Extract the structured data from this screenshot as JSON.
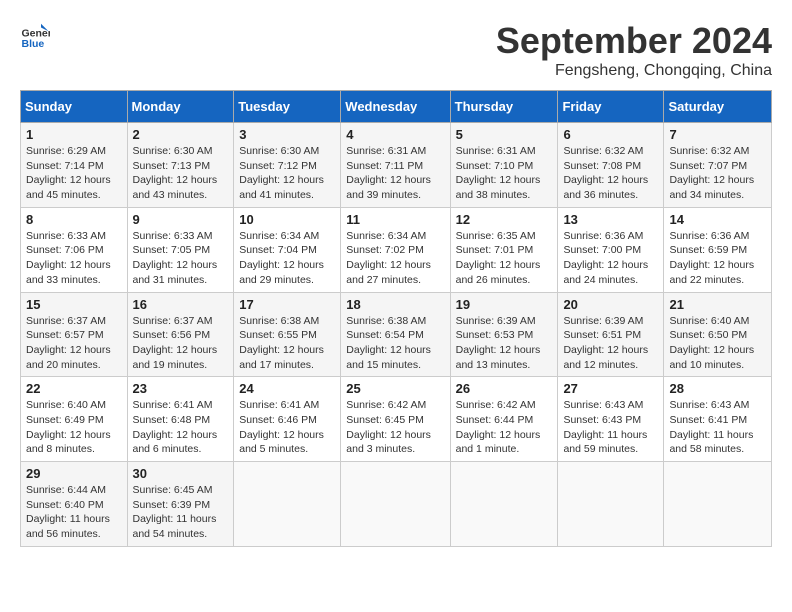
{
  "header": {
    "logo_line1": "General",
    "logo_line2": "Blue",
    "month": "September 2024",
    "location": "Fengsheng, Chongqing, China"
  },
  "weekdays": [
    "Sunday",
    "Monday",
    "Tuesday",
    "Wednesday",
    "Thursday",
    "Friday",
    "Saturday"
  ],
  "weeks": [
    [
      {
        "day": "1",
        "sunrise": "6:29 AM",
        "sunset": "7:14 PM",
        "daylight": "12 hours and 45 minutes."
      },
      {
        "day": "2",
        "sunrise": "6:30 AM",
        "sunset": "7:13 PM",
        "daylight": "12 hours and 43 minutes."
      },
      {
        "day": "3",
        "sunrise": "6:30 AM",
        "sunset": "7:12 PM",
        "daylight": "12 hours and 41 minutes."
      },
      {
        "day": "4",
        "sunrise": "6:31 AM",
        "sunset": "7:11 PM",
        "daylight": "12 hours and 39 minutes."
      },
      {
        "day": "5",
        "sunrise": "6:31 AM",
        "sunset": "7:10 PM",
        "daylight": "12 hours and 38 minutes."
      },
      {
        "day": "6",
        "sunrise": "6:32 AM",
        "sunset": "7:08 PM",
        "daylight": "12 hours and 36 minutes."
      },
      {
        "day": "7",
        "sunrise": "6:32 AM",
        "sunset": "7:07 PM",
        "daylight": "12 hours and 34 minutes."
      }
    ],
    [
      {
        "day": "8",
        "sunrise": "6:33 AM",
        "sunset": "7:06 PM",
        "daylight": "12 hours and 33 minutes."
      },
      {
        "day": "9",
        "sunrise": "6:33 AM",
        "sunset": "7:05 PM",
        "daylight": "12 hours and 31 minutes."
      },
      {
        "day": "10",
        "sunrise": "6:34 AM",
        "sunset": "7:04 PM",
        "daylight": "12 hours and 29 minutes."
      },
      {
        "day": "11",
        "sunrise": "6:34 AM",
        "sunset": "7:02 PM",
        "daylight": "12 hours and 27 minutes."
      },
      {
        "day": "12",
        "sunrise": "6:35 AM",
        "sunset": "7:01 PM",
        "daylight": "12 hours and 26 minutes."
      },
      {
        "day": "13",
        "sunrise": "6:36 AM",
        "sunset": "7:00 PM",
        "daylight": "12 hours and 24 minutes."
      },
      {
        "day": "14",
        "sunrise": "6:36 AM",
        "sunset": "6:59 PM",
        "daylight": "12 hours and 22 minutes."
      }
    ],
    [
      {
        "day": "15",
        "sunrise": "6:37 AM",
        "sunset": "6:57 PM",
        "daylight": "12 hours and 20 minutes."
      },
      {
        "day": "16",
        "sunrise": "6:37 AM",
        "sunset": "6:56 PM",
        "daylight": "12 hours and 19 minutes."
      },
      {
        "day": "17",
        "sunrise": "6:38 AM",
        "sunset": "6:55 PM",
        "daylight": "12 hours and 17 minutes."
      },
      {
        "day": "18",
        "sunrise": "6:38 AM",
        "sunset": "6:54 PM",
        "daylight": "12 hours and 15 minutes."
      },
      {
        "day": "19",
        "sunrise": "6:39 AM",
        "sunset": "6:53 PM",
        "daylight": "12 hours and 13 minutes."
      },
      {
        "day": "20",
        "sunrise": "6:39 AM",
        "sunset": "6:51 PM",
        "daylight": "12 hours and 12 minutes."
      },
      {
        "day": "21",
        "sunrise": "6:40 AM",
        "sunset": "6:50 PM",
        "daylight": "12 hours and 10 minutes."
      }
    ],
    [
      {
        "day": "22",
        "sunrise": "6:40 AM",
        "sunset": "6:49 PM",
        "daylight": "12 hours and 8 minutes."
      },
      {
        "day": "23",
        "sunrise": "6:41 AM",
        "sunset": "6:48 PM",
        "daylight": "12 hours and 6 minutes."
      },
      {
        "day": "24",
        "sunrise": "6:41 AM",
        "sunset": "6:46 PM",
        "daylight": "12 hours and 5 minutes."
      },
      {
        "day": "25",
        "sunrise": "6:42 AM",
        "sunset": "6:45 PM",
        "daylight": "12 hours and 3 minutes."
      },
      {
        "day": "26",
        "sunrise": "6:42 AM",
        "sunset": "6:44 PM",
        "daylight": "12 hours and 1 minute."
      },
      {
        "day": "27",
        "sunrise": "6:43 AM",
        "sunset": "6:43 PM",
        "daylight": "11 hours and 59 minutes."
      },
      {
        "day": "28",
        "sunrise": "6:43 AM",
        "sunset": "6:41 PM",
        "daylight": "11 hours and 58 minutes."
      }
    ],
    [
      {
        "day": "29",
        "sunrise": "6:44 AM",
        "sunset": "6:40 PM",
        "daylight": "11 hours and 56 minutes."
      },
      {
        "day": "30",
        "sunrise": "6:45 AM",
        "sunset": "6:39 PM",
        "daylight": "11 hours and 54 minutes."
      },
      null,
      null,
      null,
      null,
      null
    ]
  ]
}
